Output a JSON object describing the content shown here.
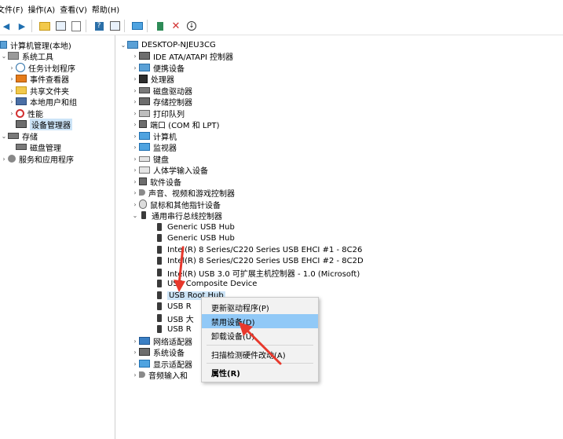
{
  "menu": [
    "文件(F)",
    "操作(A)",
    "查看(V)",
    "帮助(H)"
  ],
  "toolbar": {
    "icons": [
      "back-icon",
      "forward-icon",
      "up-folder-icon",
      "show-tree-icon",
      "properties-icon",
      "help-icon",
      "show-action-icon",
      "monitor-icon",
      "update-driver-icon",
      "uninstall-icon",
      "download-icon"
    ]
  },
  "left_tree": {
    "root": "计算机管理(本地)",
    "system_tools": "系统工具",
    "task_scheduler": "任务计划程序",
    "event_viewer": "事件查看器",
    "shared_folders": "共享文件夹",
    "local_users": "本地用户和组",
    "performance": "性能",
    "device_manager": "设备管理器",
    "storage": "存储",
    "disk_management": "磁盘管理",
    "services_apps": "服务和应用程序"
  },
  "device_tree": {
    "computer_name": "DESKTOP-NJEU3CG",
    "categories": [
      "IDE ATA/ATAPI 控制器",
      "便携设备",
      "处理器",
      "磁盘驱动器",
      "存储控制器",
      "打印队列",
      "端口 (COM 和 LPT)",
      "计算机",
      "监视器",
      "键盘",
      "人体学输入设备",
      "软件设备",
      "声音、视频和游戏控制器",
      "鼠标和其他指针设备",
      "通用串行总线控制器"
    ],
    "usb_devices": [
      "Generic USB Hub",
      "Generic USB Hub",
      "Intel(R) 8 Series/C220 Series USB EHCI #1 - 8C26",
      "Intel(R) 8 Series/C220 Series USB EHCI #2 - 8C2D",
      "Intel(R) USB 3.0 可扩展主机控制器 - 1.0 (Microsoft)",
      "USB Composite Device",
      "USB Root Hub",
      "USB R",
      "USB 大",
      "USB R"
    ],
    "after_categories": [
      "网络适配器",
      "系统设备",
      "显示适配器",
      "音频输入和"
    ]
  },
  "context_menu": {
    "update_driver": "更新驱动程序(P)",
    "disable_device": "禁用设备(D)",
    "uninstall_device": "卸载设备(U)",
    "scan_hardware": "扫描检测硬件改动(A)",
    "properties": "属性(R)"
  },
  "colors": {
    "selection": "#cce4f7",
    "menu_highlight": "#91c9f7",
    "annotation_arrow": "#e8382c"
  }
}
